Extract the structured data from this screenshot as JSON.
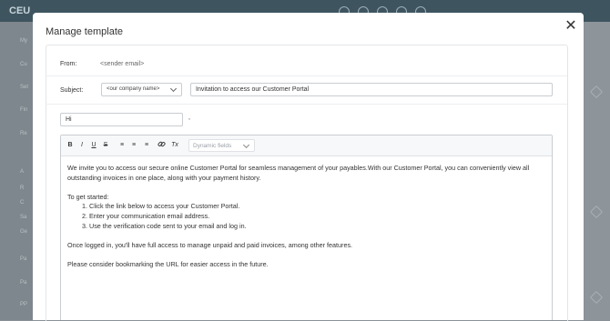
{
  "background": {
    "logo": "CEU",
    "user": "",
    "sidebar_labels": [
      "My",
      "Cu",
      "Set",
      "Fin",
      "Re",
      "",
      "A",
      "R",
      "C",
      "Sa",
      "Ge",
      "Fo",
      "Pa",
      "Pa",
      "PP"
    ]
  },
  "modal": {
    "title": "Manage template",
    "close_label": "✕",
    "from": {
      "label": "From:",
      "value": "<sender email>"
    },
    "subject": {
      "label": "Subject:",
      "select_value": "<our company name>",
      "value": "Invitation to access our Customer Portal"
    },
    "greeting": {
      "value": "Hi",
      "suffix": ","
    },
    "toolbar": {
      "bold": "B",
      "italic": "I",
      "underline": "U",
      "strike": "S",
      "ordered_list": "≡",
      "bullet_list": "≡",
      "align": "≡",
      "link": "🔗",
      "clear_format": "Tx",
      "dynamic_fields": "Dynamic fields"
    },
    "body": {
      "intro": "We invite you to access our secure online Customer Portal for seamless management of your payables.With our Customer Portal, you can conveniently view all outstanding invoices in one place, along with your payment history.",
      "steps_heading": "To get started:",
      "steps": [
        "Click the link below to access your Customer Portal.",
        "Enter your communication email address.",
        "Use the verification code sent to your email and log in."
      ],
      "after_login": "Once logged in, you'll have full access to manage unpaid and paid invoices, among other features.",
      "bookmark": "Please consider bookmarking the URL for easier access in the future."
    }
  }
}
